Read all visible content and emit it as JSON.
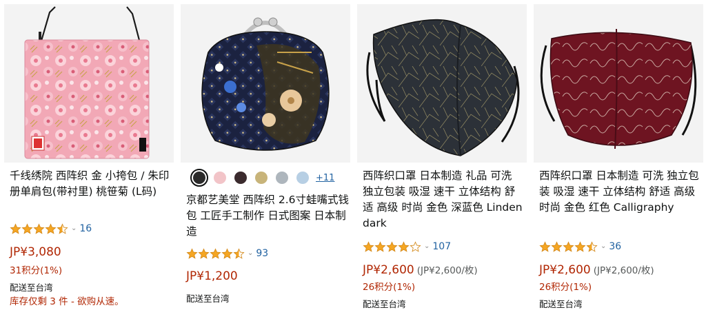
{
  "products": [
    {
      "title": "千线绣院 西阵织 金 小挎包 / 朱印册单肩包(带衬里) 桃笹菊 (L码)",
      "rating": 4.5,
      "review_count": "16",
      "price": "JP¥3,080",
      "points": "31积分(1%)",
      "shipping": "配送至台湾",
      "stock": "库存仅剩 3 件 - 欲购从速。"
    },
    {
      "title": "京都艺美堂 西阵织 2.6寸蛙嘴式钱包 工匠手工制作 日式图案 日本制造",
      "rating": 4.5,
      "review_count": "93",
      "price": "JP¥1,200",
      "shipping": "配送至台湾",
      "swatch_colors": [
        "#2b2b2b",
        "#f2c4c8",
        "#3b2b2e",
        "#c8b47a",
        "#aeb6bd",
        "#b7cfe4"
      ],
      "more_options": "+11"
    },
    {
      "title": "西阵织口罩 日本制造 礼品 可洗 独立包装 吸湿 速干 立体结构 舒适 高级 时尚 金色 深蓝色 Linden dark",
      "rating": 4.0,
      "review_count": "107",
      "price": "JP¥2,600",
      "unit_price": "(JP¥2,600/枚)",
      "points": "26积分(1%)",
      "shipping": "配送至台湾"
    },
    {
      "title": "西阵织口罩 日本制造 可洗 独立包装 吸湿 速干 立体结构 舒适 高级 时尚 金色 红色 Calligraphy",
      "rating": 4.5,
      "review_count": "36",
      "price": "JP¥2,600",
      "unit_price": "(JP¥2,600/枚)",
      "points": "26积分(1%)",
      "shipping": "配送至台湾"
    }
  ],
  "colors": {
    "price": "#b12704",
    "link": "#2162a1",
    "star": "#f5a623"
  }
}
